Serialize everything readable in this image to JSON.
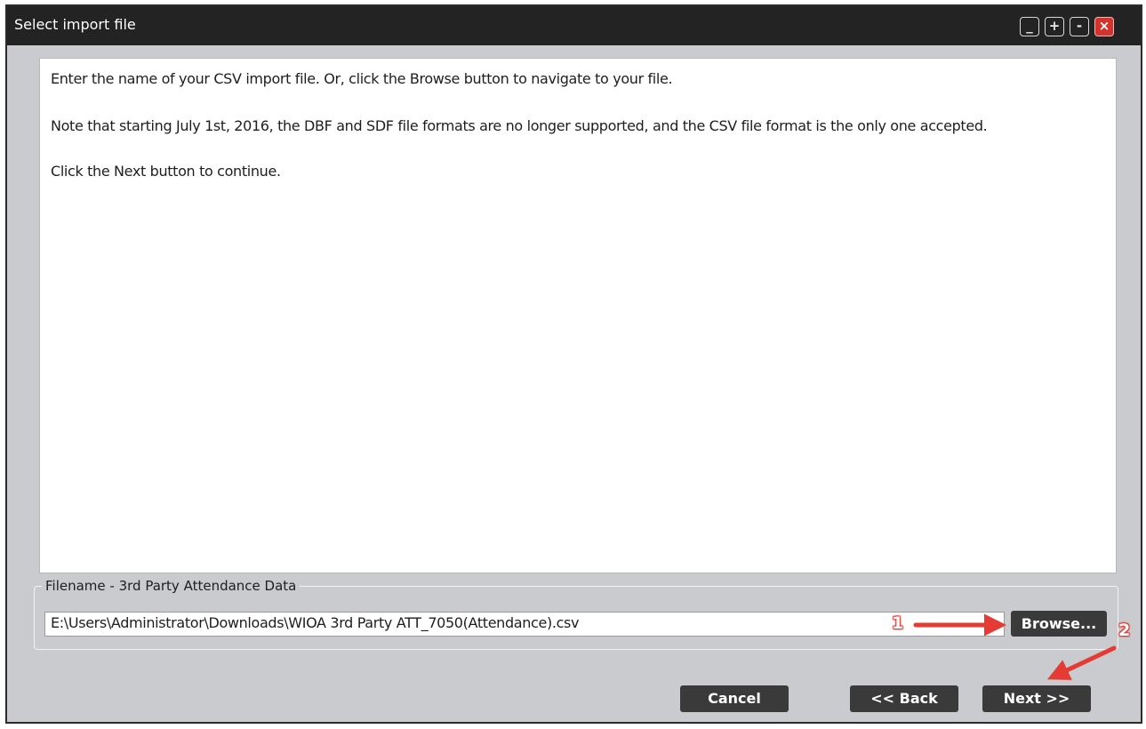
{
  "window": {
    "title": "Select import file"
  },
  "window_controls": {
    "minimize": "_",
    "expand": "+",
    "shrink": "-",
    "close": "×"
  },
  "instructions": {
    "line1": "Enter the name of your CSV import file. Or, click the Browse button to navigate to your file.",
    "line2": "Note that starting July 1st, 2016, the DBF and SDF file formats are no longer supported, and the CSV file format is the only one accepted.",
    "line3": "Click the Next button to continue."
  },
  "file_group": {
    "legend": "Filename - 3rd Party Attendance Data",
    "value": "E:\\Users\\Administrator\\Downloads\\WIOA 3rd Party ATT_7050(Attendance).csv",
    "browse_label": "Browse..."
  },
  "buttons": {
    "cancel": "Cancel",
    "back": "<< Back",
    "next": "Next >>"
  },
  "annotations": {
    "marker1": "1",
    "marker2": "2",
    "arrow_color": "#e43c34"
  },
  "colors": {
    "titlebar": "#232323",
    "dialog_bg": "#c9cbcf",
    "button_bg": "#3a3a3a",
    "close_button": "#d4322c"
  }
}
